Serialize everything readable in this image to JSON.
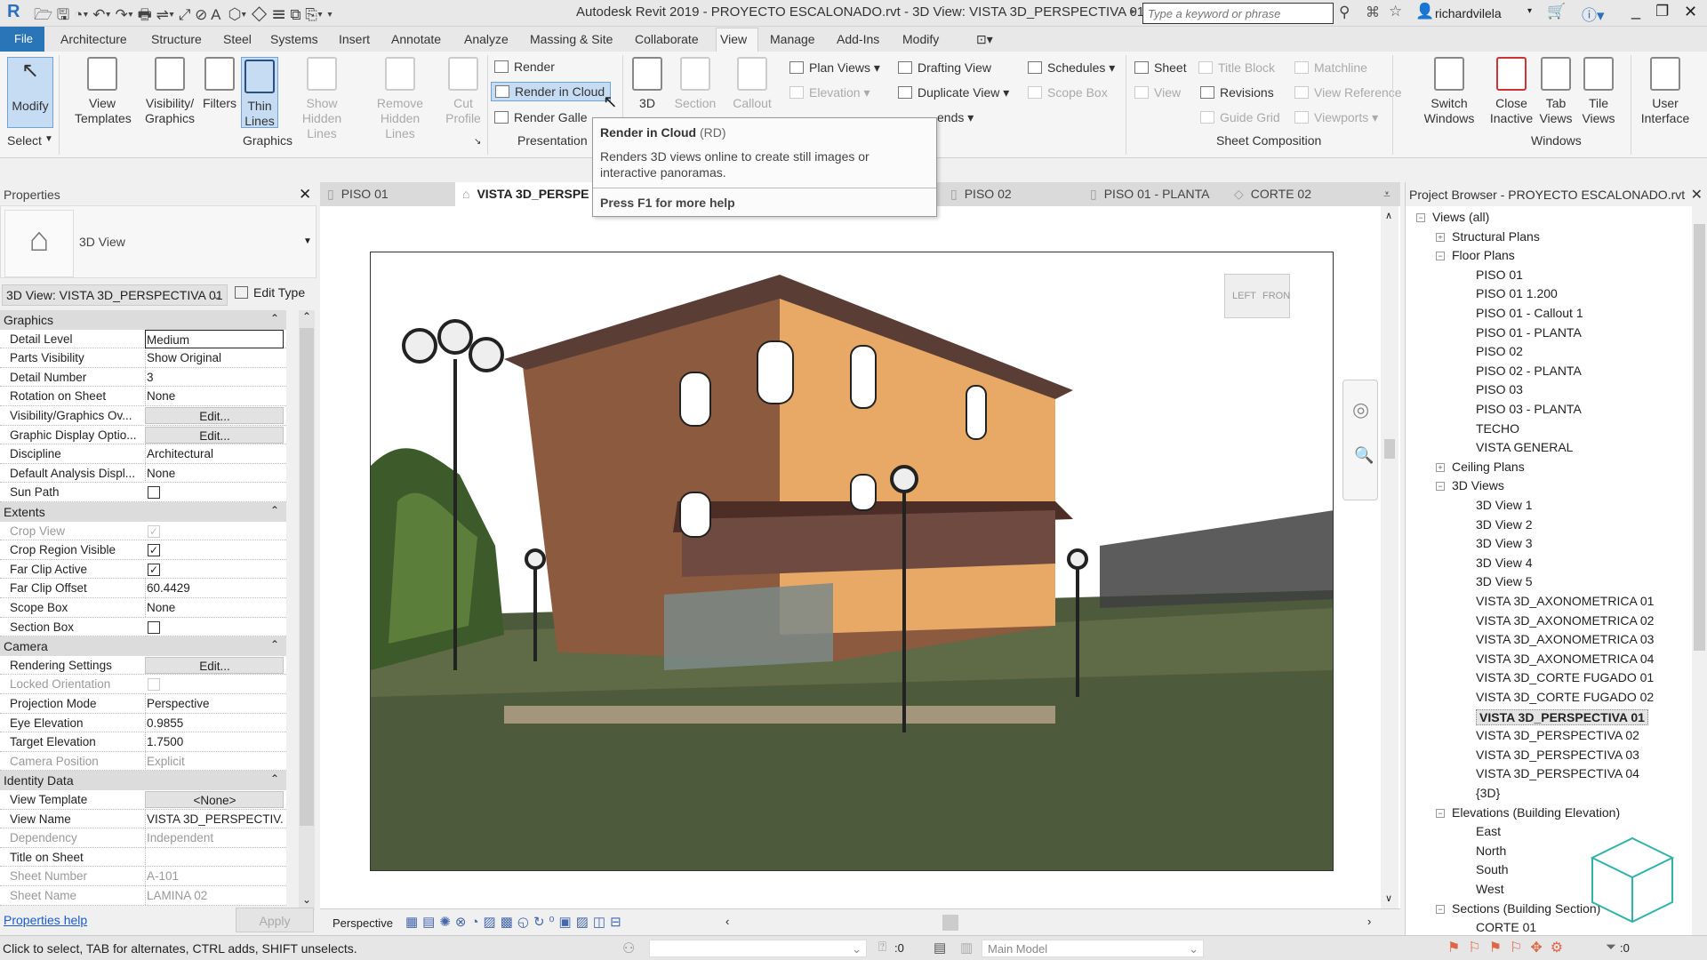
{
  "title_bar": {
    "title": "Autodesk Revit 2019 - PROYECTO ESCALONADO.rvt - 3D View: VISTA 3D_PERSPECTIVA 01",
    "search_placeholder": "Type a keyword or phrase",
    "user": "richardvilela"
  },
  "ribbon_tabs": [
    "File",
    "Architecture",
    "Structure",
    "Steel",
    "Systems",
    "Insert",
    "Annotate",
    "Analyze",
    "Massing & Site",
    "Collaborate",
    "View",
    "Manage",
    "Add-Ins",
    "Modify"
  ],
  "active_tab": "View",
  "ribbon": {
    "select": {
      "modify": "Modify",
      "panel": "Select"
    },
    "graphics": {
      "panel": "Graphics",
      "view_templates": "View Templates",
      "visibility": "Visibility/ Graphics",
      "filters": "Filters",
      "thin_lines": "Thin Lines",
      "show_hidden": "Show Hidden Lines",
      "remove_hidden": "Remove Hidden Lines",
      "cut_profile": "Cut Profile"
    },
    "presentation": {
      "panel": "Presentation",
      "render": "Render",
      "render_cloud": "Render  in Cloud",
      "render_gallery": "Render  Galle"
    },
    "create": {
      "three_d": "3D",
      "section": "Section",
      "callout": "Callout",
      "plan_views": "Plan Views",
      "elevation": "Elevation",
      "drafting_view": "Drafting View",
      "duplicate_view": "Duplicate View",
      "legends": "ends",
      "schedules": "Schedules",
      "scope_box": "Scope Box"
    },
    "sheet_composition": {
      "panel": "Sheet Composition",
      "sheet": "Sheet",
      "title_block": "Title Block",
      "matchline": "Matchline",
      "view": "View",
      "revisions": "Revisions",
      "view_reference": "View Reference",
      "guide_grid": "Guide Grid",
      "viewports": "Viewports"
    },
    "windows": {
      "panel": "Windows",
      "switch": "Switch Windows",
      "close_inactive": "Close Inactive",
      "tab_views": "Tab Views",
      "tile_views": "Tile Views"
    },
    "user_interface": "User Interface"
  },
  "tooltip": {
    "title": "Render in Cloud",
    "shortcut": "(RD)",
    "description": "Renders 3D views online to create still images or interactive panoramas.",
    "help": "Press F1 for more help"
  },
  "properties": {
    "title": "Properties",
    "type_name": "3D View",
    "instance_selector": "3D View: VISTA 3D_PERSPECTIVA 01",
    "edit_type": "Edit Type",
    "help": "Properties help",
    "apply": "Apply",
    "groups": [
      {
        "name": "Graphics",
        "rows": [
          {
            "k": "Detail Level",
            "v": "Medium",
            "t": "field"
          },
          {
            "k": "Parts Visibility",
            "v": "Show Original"
          },
          {
            "k": "Detail Number",
            "v": "3"
          },
          {
            "k": "Rotation on Sheet",
            "v": "None"
          },
          {
            "k": "Visibility/Graphics Ov...",
            "v": "Edit...",
            "t": "btn"
          },
          {
            "k": "Graphic Display Optio...",
            "v": "Edit...",
            "t": "btn"
          },
          {
            "k": "Discipline",
            "v": "Architectural"
          },
          {
            "k": "Default Analysis Displ...",
            "v": "None"
          },
          {
            "k": "Sun Path",
            "checked": false,
            "t": "cb"
          }
        ]
      },
      {
        "name": "Extents",
        "rows": [
          {
            "k": "Crop View",
            "checked": true,
            "t": "cb",
            "dis": true
          },
          {
            "k": "Crop Region Visible",
            "checked": true,
            "t": "cb"
          },
          {
            "k": "Far Clip Active",
            "checked": true,
            "t": "cb"
          },
          {
            "k": "Far Clip Offset",
            "v": "60.4429"
          },
          {
            "k": "Scope Box",
            "v": "None"
          },
          {
            "k": "Section Box",
            "checked": false,
            "t": "cb"
          }
        ]
      },
      {
        "name": "Camera",
        "rows": [
          {
            "k": "Rendering Settings",
            "v": "Edit...",
            "t": "btn"
          },
          {
            "k": "Locked Orientation",
            "checked": false,
            "t": "cb",
            "dis": true
          },
          {
            "k": "Projection Mode",
            "v": "Perspective"
          },
          {
            "k": "Eye Elevation",
            "v": "0.9855"
          },
          {
            "k": "Target Elevation",
            "v": "1.7500"
          },
          {
            "k": "Camera Position",
            "v": "Explicit",
            "dis": true
          }
        ]
      },
      {
        "name": "Identity Data",
        "rows": [
          {
            "k": "View Template",
            "v": "<None>",
            "t": "btn"
          },
          {
            "k": "View Name",
            "v": "VISTA 3D_PERSPECTIV..."
          },
          {
            "k": "Dependency",
            "v": "Independent",
            "dis": true
          },
          {
            "k": "Title on Sheet",
            "v": ""
          },
          {
            "k": "Sheet Number",
            "v": "A-101",
            "dis": true
          },
          {
            "k": "Sheet Name",
            "v": "LAMINA 02",
            "dis": true
          }
        ]
      }
    ]
  },
  "view_tabs": [
    {
      "label": "PISO 01",
      "active": false
    },
    {
      "label": "VISTA 3D_PERSPE",
      "active": true
    },
    {
      "label": "PISO 02",
      "active": false
    },
    {
      "label": "PISO 01 - PLANTA",
      "active": false
    },
    {
      "label": "CORTE 02",
      "active": false
    }
  ],
  "viewcube": {
    "left": "LEFT",
    "front": "FRON"
  },
  "view_control": {
    "mode": "Perspective"
  },
  "browser": {
    "title": "Project Browser - PROYECTO ESCALONADO.rvt",
    "items": [
      {
        "label": "Views (all)",
        "lvl": 0,
        "exp": "-"
      },
      {
        "label": "Structural Plans",
        "lvl": 1,
        "exp": "+"
      },
      {
        "label": "Floor Plans",
        "lvl": 1,
        "exp": "-"
      },
      {
        "label": "PISO 01",
        "lvl": 2
      },
      {
        "label": "PISO 01 1.200",
        "lvl": 2
      },
      {
        "label": "PISO 01 - Callout 1",
        "lvl": 2
      },
      {
        "label": "PISO 01 - PLANTA",
        "lvl": 2
      },
      {
        "label": "PISO 02",
        "lvl": 2
      },
      {
        "label": "PISO 02 - PLANTA",
        "lvl": 2
      },
      {
        "label": "PISO 03",
        "lvl": 2
      },
      {
        "label": "PISO 03 - PLANTA",
        "lvl": 2
      },
      {
        "label": "TECHO",
        "lvl": 2
      },
      {
        "label": "VISTA GENERAL",
        "lvl": 2
      },
      {
        "label": "Ceiling Plans",
        "lvl": 1,
        "exp": "+"
      },
      {
        "label": "3D Views",
        "lvl": 1,
        "exp": "-"
      },
      {
        "label": "3D View 1",
        "lvl": 2
      },
      {
        "label": "3D View 2",
        "lvl": 2
      },
      {
        "label": "3D View 3",
        "lvl": 2
      },
      {
        "label": "3D View 4",
        "lvl": 2
      },
      {
        "label": "3D View 5",
        "lvl": 2
      },
      {
        "label": "VISTA 3D_AXONOMETRICA 01",
        "lvl": 2
      },
      {
        "label": "VISTA 3D_AXONOMETRICA 02",
        "lvl": 2
      },
      {
        "label": "VISTA 3D_AXONOMETRICA 03",
        "lvl": 2
      },
      {
        "label": "VISTA 3D_AXONOMETRICA 04",
        "lvl": 2
      },
      {
        "label": "VISTA 3D_CORTE FUGADO 01",
        "lvl": 2
      },
      {
        "label": "VISTA 3D_CORTE FUGADO 02",
        "lvl": 2
      },
      {
        "label": "VISTA 3D_PERSPECTIVA 01",
        "lvl": 2,
        "sel": true
      },
      {
        "label": "VISTA 3D_PERSPECTIVA 02",
        "lvl": 2
      },
      {
        "label": "VISTA 3D_PERSPECTIVA 03",
        "lvl": 2
      },
      {
        "label": "VISTA 3D_PERSPECTIVA 04",
        "lvl": 2
      },
      {
        "label": "{3D}",
        "lvl": 2
      },
      {
        "label": "Elevations (Building Elevation)",
        "lvl": 1,
        "exp": "-"
      },
      {
        "label": "East",
        "lvl": 2
      },
      {
        "label": "North",
        "lvl": 2
      },
      {
        "label": "South",
        "lvl": 2
      },
      {
        "label": "West",
        "lvl": 2
      },
      {
        "label": "Sections (Building Section)",
        "lvl": 1,
        "exp": "-"
      },
      {
        "label": "CORTE 01",
        "lvl": 2
      }
    ]
  },
  "status_bar": {
    "message": "Click to select, TAB for alternates, CTRL adds, SHIFT unselects.",
    "workset_count": ":0",
    "model": "Main Model",
    "filter_count": ":0"
  },
  "colors": {
    "accent": "#2a74b8",
    "selected_button": "#c5dcf3"
  }
}
